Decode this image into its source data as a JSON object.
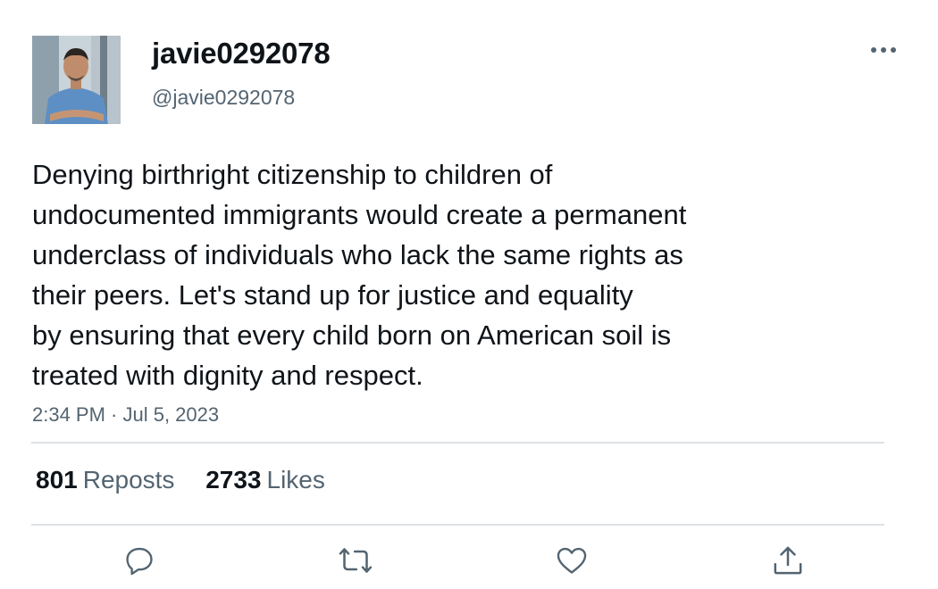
{
  "author": {
    "display_name": "javie0292078",
    "handle": "@javie0292078",
    "avatar_icon": "profile-photo"
  },
  "tweet": {
    "text_lines": [
      "Denying birthright citizenship to children of",
      "undocumented immigrants would create a permanent",
      "underclass of individuals who lack the same rights as",
      "their peers. Let's stand up for justice and equality",
      "by ensuring that every child born on American soil is",
      "treated with dignity and respect."
    ],
    "timestamp": "2:34 PM · Jul 5, 2023"
  },
  "stats": {
    "reposts_count": "801",
    "reposts_label": "Reposts",
    "likes_count": "2733",
    "likes_label": "Likes"
  },
  "actions": {
    "reply_icon": "speech-bubble-icon",
    "repost_icon": "repost-arrows-icon",
    "like_icon": "heart-icon",
    "share_icon": "share-upload-icon",
    "more_icon": "ellipsis-icon"
  },
  "colors": {
    "text_primary": "#0f1419",
    "text_secondary": "#536471",
    "divider": "#dde1e5",
    "icon": "#536471"
  }
}
